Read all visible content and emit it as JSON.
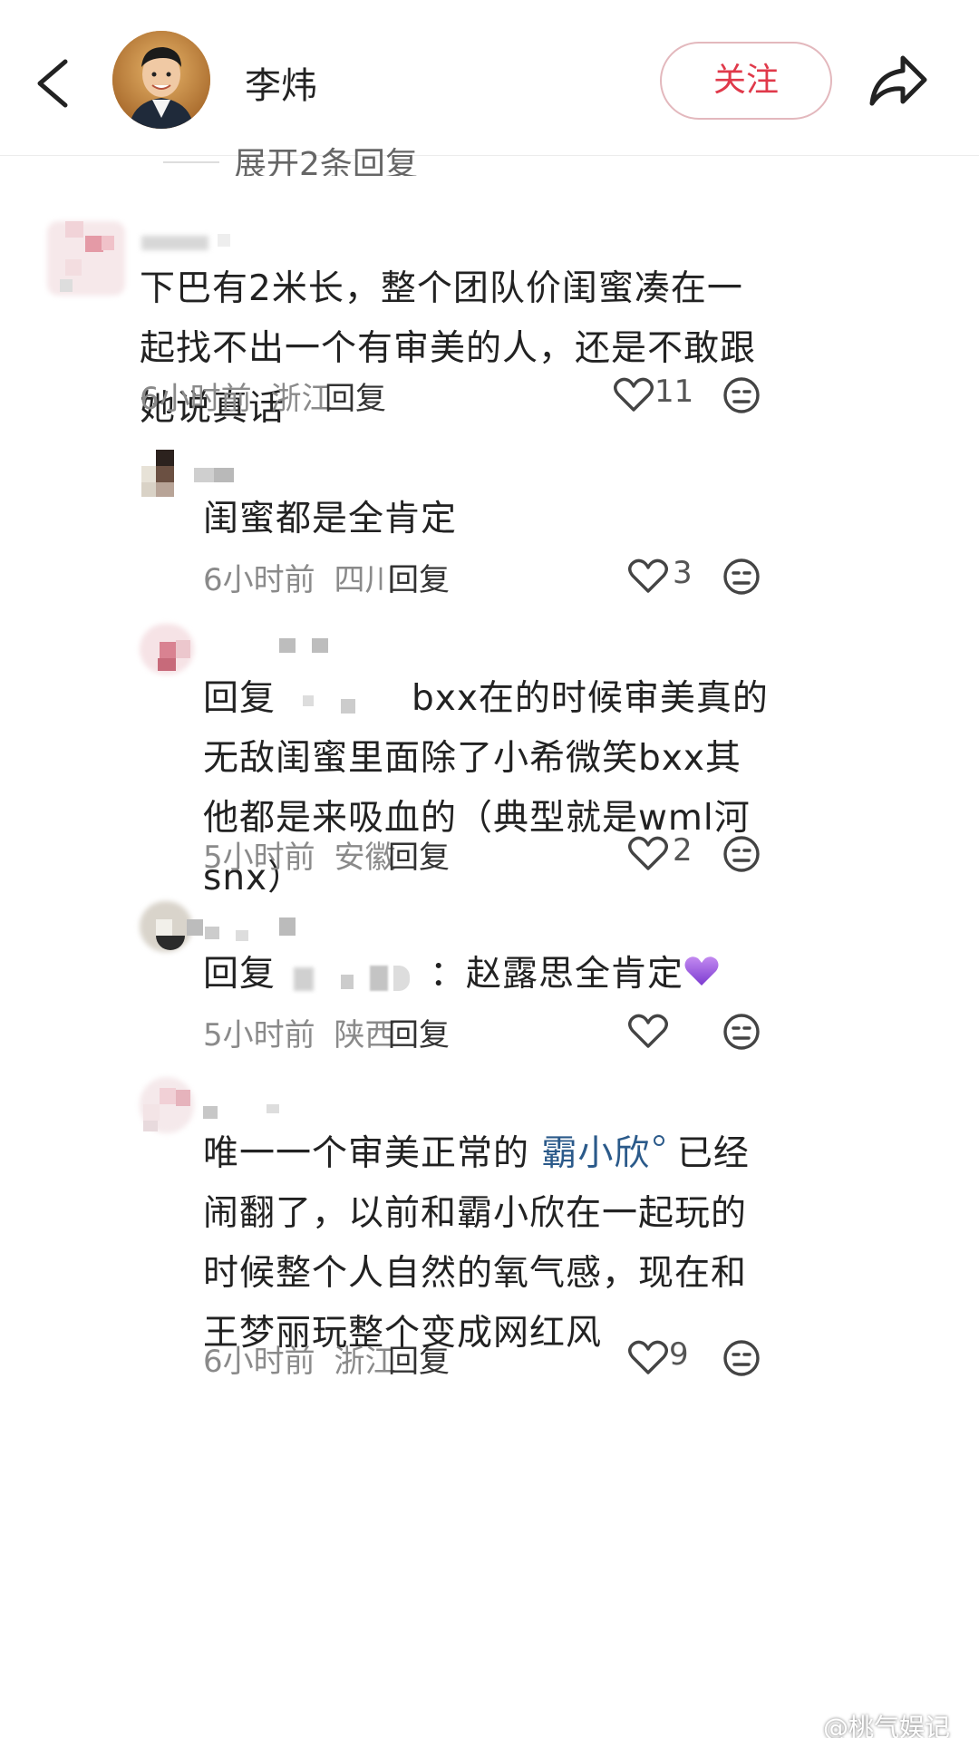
{
  "header": {
    "username": "李炜",
    "follow_label": "关注"
  },
  "thread": {
    "expand_label": "展开2条回复"
  },
  "comments": [
    {
      "text": "下巴有2米长，整个团队价闺蜜凑在一起找不出一个有审美的人，还是不敢跟她说真话",
      "time": "6小时前",
      "location": "浙江",
      "reply_label": "回复",
      "likes": "11"
    },
    {
      "text": "闺蜜都是全肯定",
      "time": "6小时前",
      "location": "四川",
      "reply_label": "回复",
      "likes": "3"
    },
    {
      "reply_prefix": "回复",
      "text": "bxx在的时候审美真的无敌闺蜜里面除了小希微笑bxx其他都是来吸血的（典型就是wml河snx）",
      "time": "5小时前",
      "location": "安徽",
      "reply_label": "回复",
      "likes": "2"
    },
    {
      "reply_prefix": "回复",
      "text": "：赵露思全肯定",
      "time": "5小时前",
      "location": "陕西",
      "reply_label": "回复",
      "likes": ""
    },
    {
      "text_before_mention": "唯一一个审美正常的",
      "mention": "霸小欣",
      "text_after_mention": "已经闹翻了，以前和霸小欣在一起玩的时候整个人自然的氧气感，现在和王梦丽玩整个变成网红风",
      "time": "6小时前",
      "location": "浙江",
      "reply_label": "回复",
      "likes": "9"
    }
  ],
  "watermark": "@桃气娱记",
  "colors": {
    "follow_red": "#e0394a",
    "mention_blue": "#2b5a8a",
    "meta_gray": "#8a8a8a"
  },
  "icons": [
    "back-arrow-icon",
    "share-icon",
    "heart-icon",
    "dislike-face-icon",
    "purple-heart-emoji",
    "weibo-icon"
  ]
}
